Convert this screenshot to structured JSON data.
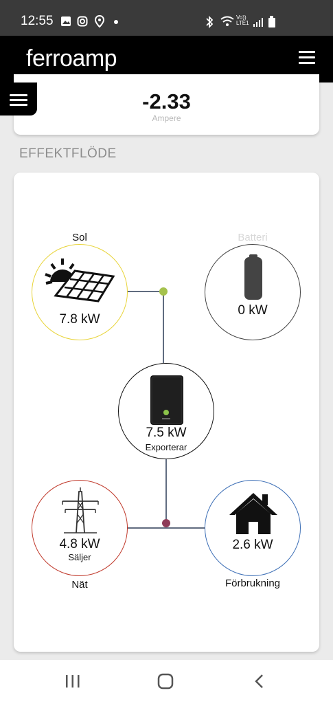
{
  "status_bar": {
    "time": "12:55",
    "lte_label": "Vo)) LTE1"
  },
  "app_bar": {
    "logo_bold": "ferro",
    "logo_light": "amp"
  },
  "top_card": {
    "value": "-2.33",
    "unit_label": "Ampere"
  },
  "section": {
    "title": "EFFEKTFLÖDE"
  },
  "flow": {
    "solar": {
      "caption": "Sol",
      "value": "7.8 kW",
      "ring_color": "#e8d43a"
    },
    "battery": {
      "caption": "Batteri",
      "value": "0 kW",
      "ring_color": "#444444"
    },
    "inverter": {
      "value": "7.5 kW",
      "status": "Exporterar",
      "ring_color": "#111111"
    },
    "grid": {
      "caption": "Nät",
      "value": "4.8 kW",
      "status": "Säljer",
      "ring_color": "#c0392b"
    },
    "consumption": {
      "caption": "Förbrukning",
      "value": "2.6 kW",
      "ring_color": "#3d6fb6"
    },
    "colors": {
      "line": "#2b3a55",
      "junction_top": "#a5c24d",
      "junction_bottom": "#8e3b58"
    }
  },
  "nav": {
    "recent_icon": "recent-apps-icon",
    "home_icon": "home-icon",
    "back_icon": "back-icon"
  }
}
